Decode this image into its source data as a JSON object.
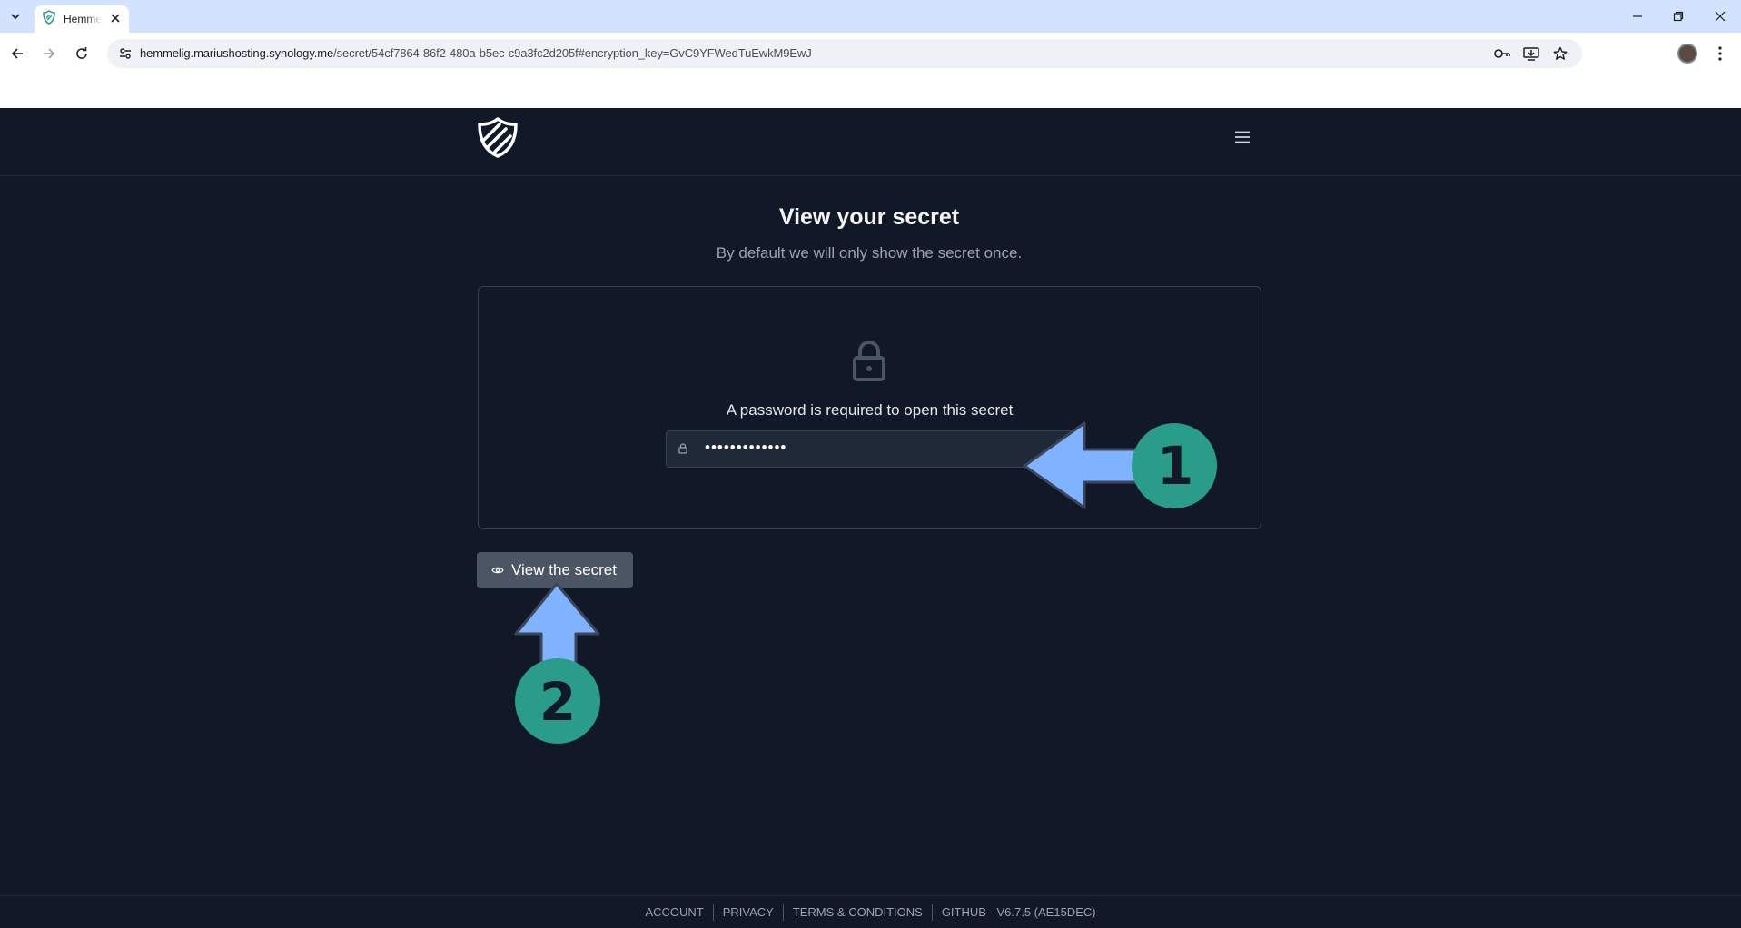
{
  "browser": {
    "tab_title": "Hemmelig",
    "url_host": "hemmelig.mariushosting.synology.me",
    "url_path": "/secret/54cf7864-86f2-480a-b5ec-c9a3fc2d205f#encryption_key=GvC9YFWedTuEwkM9EwJ",
    "icons": [
      "tab-search-icon",
      "favicon",
      "close-icon",
      "minimize-icon",
      "restore-icon",
      "window-close-icon",
      "back-icon",
      "forward-icon",
      "reload-icon",
      "site-info-icon",
      "password-key-icon",
      "install-app-icon",
      "bookmark-star-icon",
      "profile-avatar",
      "kebab-menu-icon"
    ]
  },
  "page": {
    "title": "View your secret",
    "subtitle": "By default we will only show the secret once.",
    "password_label": "A password is required to open this secret",
    "password_value": "•••••••••••••",
    "view_button": "View the secret"
  },
  "annotations": {
    "badge_1": "1",
    "badge_2": "2",
    "arrow_color": "#7fb3ff",
    "badge_color": "#2a9d8a"
  },
  "footer": {
    "links": [
      "ACCOUNT",
      "PRIVACY",
      "TERMS & CONDITIONS",
      "GITHUB - V6.7.5 (AE15DEC)"
    ]
  },
  "colors": {
    "page_bg": "#111827",
    "tabbar_bg": "#d3e3fd",
    "button_bg": "#4b5563"
  }
}
